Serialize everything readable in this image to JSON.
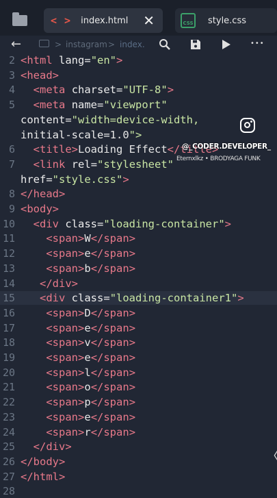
{
  "tabs": [
    {
      "icon": "< >",
      "label": "index.html",
      "close": "✕"
    },
    {
      "icon": "CSS",
      "label": "style.css"
    }
  ],
  "toolbar": {
    "back": "←",
    "crumbs": [
      "instagram",
      "index."
    ],
    "sep": ">",
    "search": "⚲",
    "save": "💾",
    "run": "▶",
    "more": "•••"
  },
  "overlay": {
    "handle": "@_CODER.DEVELOPER_",
    "credit": "Eternxlkz • BRODYAGA FUNK",
    "side_arrow": "〈"
  },
  "code_lines": [
    {
      "n": "2",
      "text": "<html lang=\"en\">"
    },
    {
      "n": "3",
      "text": "<head>"
    },
    {
      "n": "4",
      "text": "  <meta charset=\"UTF-8\">"
    },
    {
      "n": "5",
      "text": "  <meta name=\"viewport\""
    },
    {
      "n": "",
      "text": "content=\"width=device-width,"
    },
    {
      "n": "",
      "text": "initial-scale=1.0\">"
    },
    {
      "n": "6",
      "text": "  <title>Loading Effect</title>"
    },
    {
      "n": "7",
      "text": "  <link rel=\"stylesheet\""
    },
    {
      "n": "",
      "text": "href=\"style.css\">"
    },
    {
      "n": "8",
      "text": "</head>"
    },
    {
      "n": "9",
      "text": "<body>"
    },
    {
      "n": "10",
      "text": "  <div class=\"loading-container\">"
    },
    {
      "n": "11",
      "text": "    <span>W</span>"
    },
    {
      "n": "12",
      "text": "    <span>e</span>"
    },
    {
      "n": "13",
      "text": "    <span>b</span>"
    },
    {
      "n": "14",
      "text": "   </div>"
    },
    {
      "n": "15",
      "text": "   <div class=\"loading-container1\">"
    },
    {
      "n": "16",
      "text": "    <span>D</span>"
    },
    {
      "n": "17",
      "text": "    <span>e</span>"
    },
    {
      "n": "18",
      "text": "    <span>v</span>"
    },
    {
      "n": "19",
      "text": "    <span>e</span>"
    },
    {
      "n": "20",
      "text": "    <span>l</span>"
    },
    {
      "n": "21",
      "text": "    <span>o</span>"
    },
    {
      "n": "22",
      "text": "    <span>p</span>"
    },
    {
      "n": "23",
      "text": "    <span>e</span>"
    },
    {
      "n": "24",
      "text": "    <span>r</span>"
    },
    {
      "n": "25",
      "text": "  </div>"
    },
    {
      "n": "26",
      "text": "</body>"
    },
    {
      "n": "27",
      "text": "</html>"
    },
    {
      "n": "28",
      "text": ""
    }
  ],
  "highlighted_line": "15",
  "colors": {
    "background": "#212734",
    "tag": "#e8798a",
    "string": "#c9e6a4",
    "attribute": "#ececec",
    "line_number": "#6b7685",
    "html_icon": "#e4574a",
    "css_icon": "#3ca16a"
  }
}
